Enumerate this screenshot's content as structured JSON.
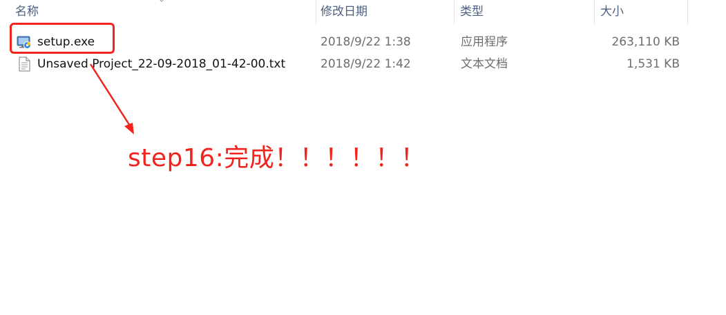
{
  "columns": {
    "name": "名称",
    "modified": "修改日期",
    "type": "类型",
    "size": "大小"
  },
  "files": [
    {
      "name": "setup.exe",
      "modified": "2018/9/22 1:38",
      "type": "应用程序",
      "size": "263,110 KB",
      "icon": "setup-exe-icon"
    },
    {
      "name": "Unsaved Project_22-09-2018_01-42-00.txt",
      "modified": "2018/9/22 1:42",
      "type": "文本文档",
      "size": "1,531 KB",
      "icon": "text-document-icon"
    }
  ],
  "annotation": {
    "text": "step16:完成！！！！！！",
    "color": "#f2231d"
  }
}
